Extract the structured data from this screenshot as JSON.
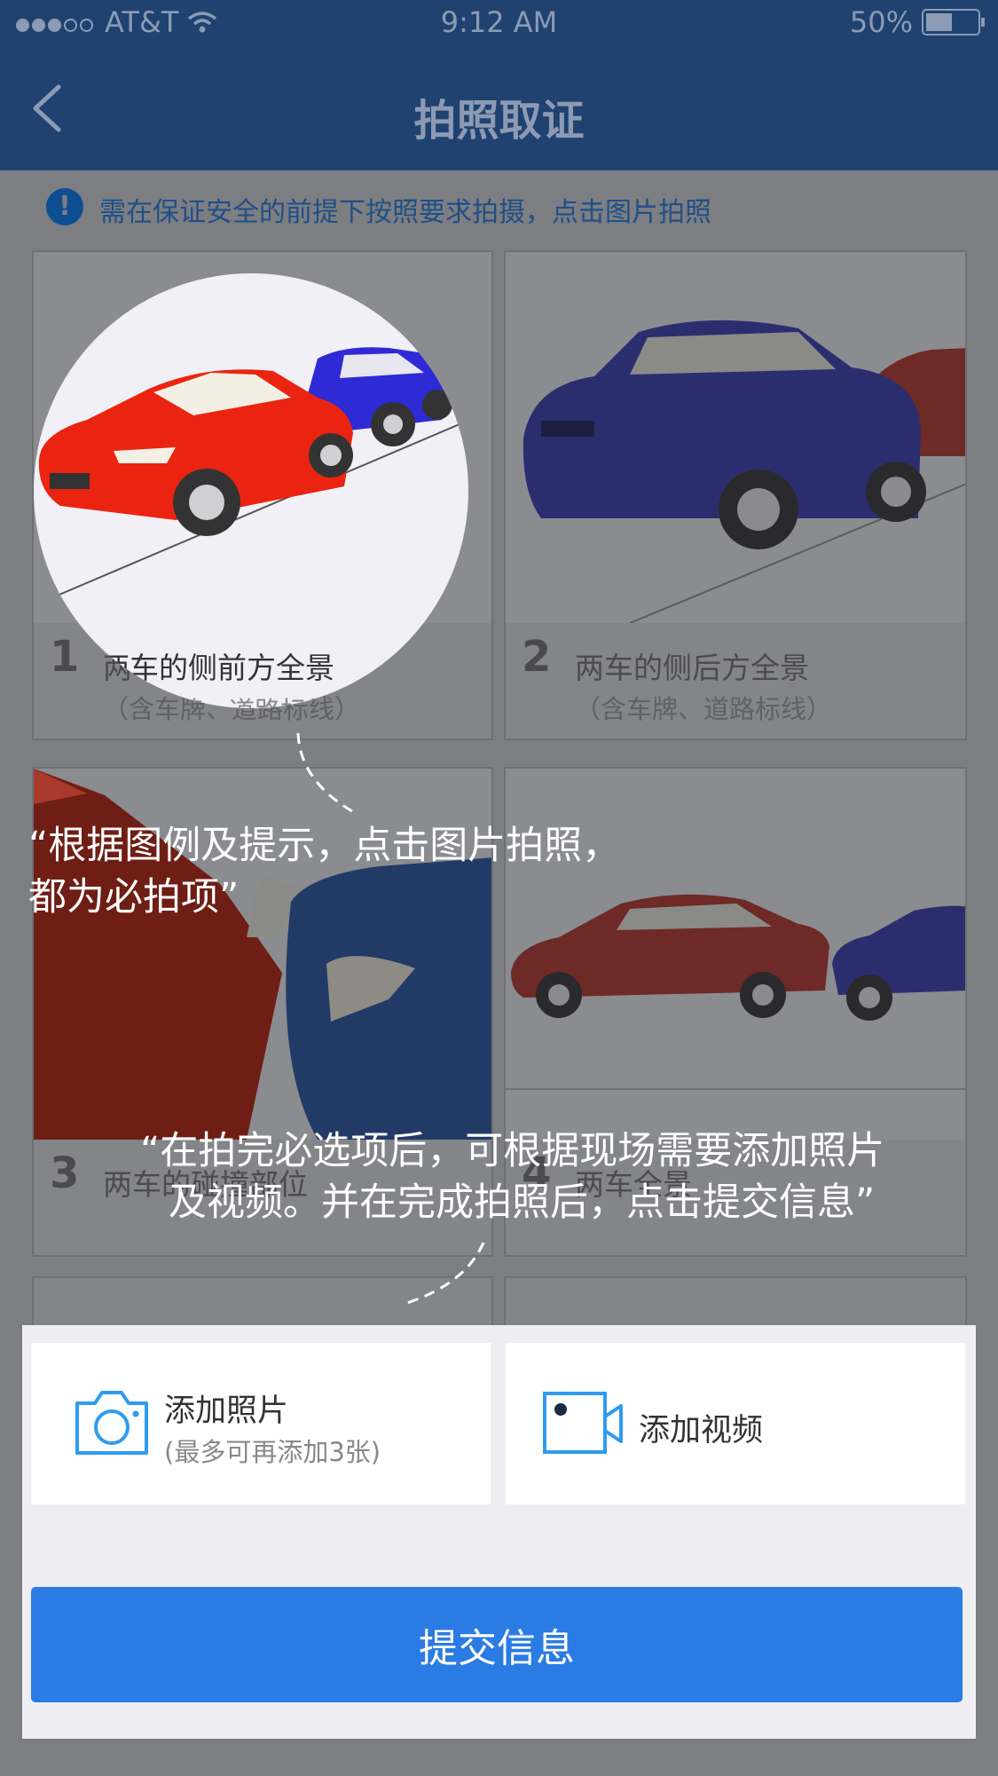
{
  "status_bar": {
    "carrier": "AT&T",
    "time": "9:12 AM",
    "battery": "50%"
  },
  "nav": {
    "title": "拍照取证"
  },
  "tip": {
    "icon": "exclamation-icon",
    "text": "需在保证安全的前提下按照要求拍摄，点击图片拍照"
  },
  "cards": [
    {
      "number": "1",
      "label": "两车的侧前方全景",
      "sub": "（含车牌、道路标线）"
    },
    {
      "number": "2",
      "label": "两车的侧后方全景",
      "sub": "（含车牌、道路标线）"
    },
    {
      "number": "3",
      "label": "两车的碰撞部位"
    },
    {
      "number": "4",
      "label": "两车全景"
    }
  ],
  "callouts": {
    "first": "“根据图例及提示，点击图片拍照，都为必拍项”",
    "second_line1": "“在拍完必选项后，可根据现场需要添加照片",
    "second_line2": "及视频。并在完成拍照后，点击提交信息”"
  },
  "actions": {
    "add_photo": {
      "title": "添加照片",
      "sub": "(最多可再添加3张)",
      "icon": "camera-icon"
    },
    "add_video": {
      "title": "添加视频",
      "icon": "video-camera-icon"
    },
    "submit": "提交信息"
  },
  "colors": {
    "nav": "#1f4270",
    "accent": "#2b7be4",
    "icon_blue": "#2e9bf0",
    "overlay": "#7d7e82"
  }
}
